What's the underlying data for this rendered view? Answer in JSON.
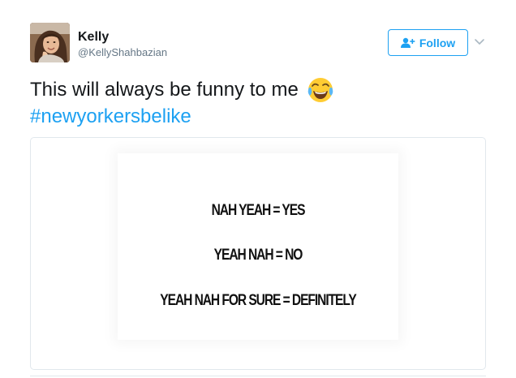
{
  "tweet": {
    "author": {
      "display_name": "Kelly",
      "screen_name": "@KellyShahbazian",
      "avatar_icon": "profile-photo"
    },
    "follow_button": {
      "label": "Follow",
      "icon": "add-user-icon"
    },
    "menu_icon": "chevron-down-icon",
    "text": "This will always be funny to me",
    "emoji": "face-with-tears-of-joy",
    "hashtag": "#newyorkersbelike",
    "media": {
      "lines": [
        "NAH YEAH = YES",
        "YEAH NAH = NO",
        "YEAH NAH FOR SURE  = DEFINITELY"
      ]
    }
  },
  "colors": {
    "link": "#1da1f2",
    "text": "#14171a",
    "muted": "#657786",
    "border": "#e1e8ed"
  }
}
